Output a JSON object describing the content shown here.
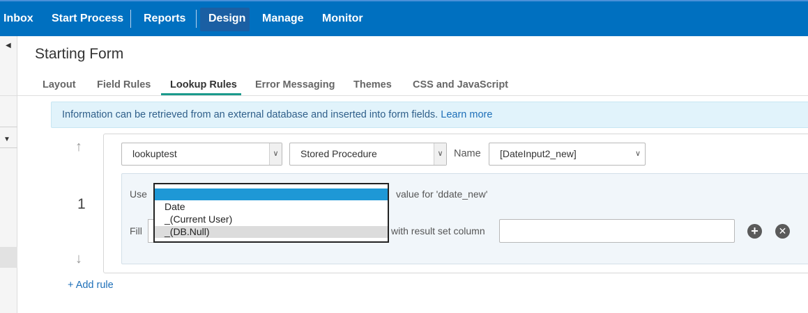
{
  "nav": {
    "items": [
      "Inbox",
      "Start Process",
      "Reports",
      "Design",
      "Manage",
      "Monitor"
    ],
    "active": "Design"
  },
  "page": {
    "title": "Starting Form"
  },
  "tabs": [
    "Layout",
    "Field Rules",
    "Lookup Rules",
    "Error Messaging",
    "Themes",
    "CSS and JavaScript"
  ],
  "active_tab": "Lookup Rules",
  "info": {
    "text": "Information can be retrieved from an external database and inserted into form fields.",
    "link": "Learn more"
  },
  "rule": {
    "number": "1",
    "connection": "lookuptest",
    "type": "Stored Procedure",
    "name_label": "Name",
    "name_value": "[DateInput2_new]",
    "use_label": "Use",
    "value_for": "value for 'ddate_new'",
    "fill_label": "Fill",
    "with_result": "with result set column",
    "dropdown_options": [
      "",
      "Date",
      "_(Current User)",
      "_(DB.Null)"
    ]
  },
  "add_rule": "+ Add rule",
  "icons": {
    "up": "arrow-up-icon",
    "down": "arrow-down-icon",
    "add": "plus-circle-icon",
    "remove": "close-circle-icon"
  },
  "colors": {
    "nav_bg": "#0070c0",
    "accent_tab": "#1a9a8c",
    "info_bg": "#e1f3fb",
    "dropdown_selected": "#1e98d6"
  }
}
